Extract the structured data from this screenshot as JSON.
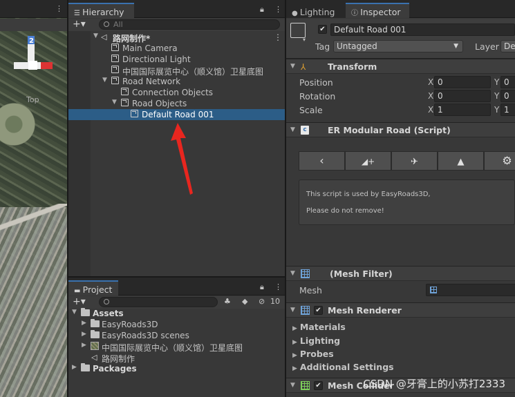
{
  "scene": {
    "gizmo_label": "Top",
    "gizmo_number": "2"
  },
  "hierarchy": {
    "tab_label": "Hierarchy",
    "search_placeholder": "All",
    "items": [
      {
        "label": "路网制作*",
        "icon": "scene-icon",
        "depth": 0,
        "expanded": true
      },
      {
        "label": "Main Camera",
        "icon": "cube-icon",
        "depth": 1
      },
      {
        "label": "Directional Light",
        "icon": "cube-icon",
        "depth": 1
      },
      {
        "label": "中国国际展览中心（顺义馆）卫星底图",
        "icon": "cube-icon",
        "depth": 1
      },
      {
        "label": "Road Network",
        "icon": "cube-icon",
        "depth": 1,
        "expanded": true
      },
      {
        "label": "Connection Objects",
        "icon": "cube-icon",
        "depth": 2
      },
      {
        "label": "Road Objects",
        "icon": "cube-icon",
        "depth": 2,
        "expanded": true
      },
      {
        "label": "Default Road 001",
        "icon": "cube-icon",
        "depth": 3,
        "selected": true
      }
    ]
  },
  "project": {
    "tab_label": "Project",
    "hidden_count": "10",
    "items": [
      {
        "label": "Assets",
        "icon": "folder-open-icon",
        "depth": 0,
        "bold": true
      },
      {
        "label": "EasyRoads3D",
        "icon": "folder-icon",
        "depth": 1
      },
      {
        "label": "EasyRoads3D scenes",
        "icon": "folder-icon",
        "depth": 1
      },
      {
        "label": "中国国际展览中心（顺义馆）卫星底图",
        "icon": "image-icon",
        "depth": 1
      },
      {
        "label": "路网制作",
        "icon": "scene-icon",
        "depth": 1
      },
      {
        "label": "Packages",
        "icon": "folder-icon",
        "depth": 0,
        "bold": true
      }
    ]
  },
  "right_tabs": {
    "lighting": "Lighting",
    "inspector": "Inspector"
  },
  "inspector": {
    "object_name": "Default Road 001",
    "tag_label": "Tag",
    "tag_value": "Untagged",
    "layer_label": "Layer",
    "layer_value": "Def",
    "transform": {
      "title": "Transform",
      "position_label": "Position",
      "rotation_label": "Rotation",
      "scale_label": "Scale",
      "position": {
        "x": "0",
        "y": "0"
      },
      "rotation": {
        "x": "0",
        "y": "0"
      },
      "scale": {
        "x": "1",
        "y": "1"
      }
    },
    "er_script": {
      "title": "ER Modular Road (Script)",
      "help_line1": "This script is used by EasyRoads3D,",
      "help_line2": "Please do not remove!"
    },
    "mesh_filter": {
      "title": "(Mesh Filter)",
      "mesh_label": "Mesh"
    },
    "mesh_renderer": {
      "title": "Mesh Renderer",
      "sections": [
        "Materials",
        "Lighting",
        "Probes",
        "Additional Settings"
      ]
    },
    "mesh_collider": {
      "title": "Mesh Collider"
    }
  },
  "watermark": "CSDN @牙膏上的小苏打2333",
  "colors": {
    "selection": "#2c5d87",
    "annotation_arrow": "#e8261f"
  }
}
